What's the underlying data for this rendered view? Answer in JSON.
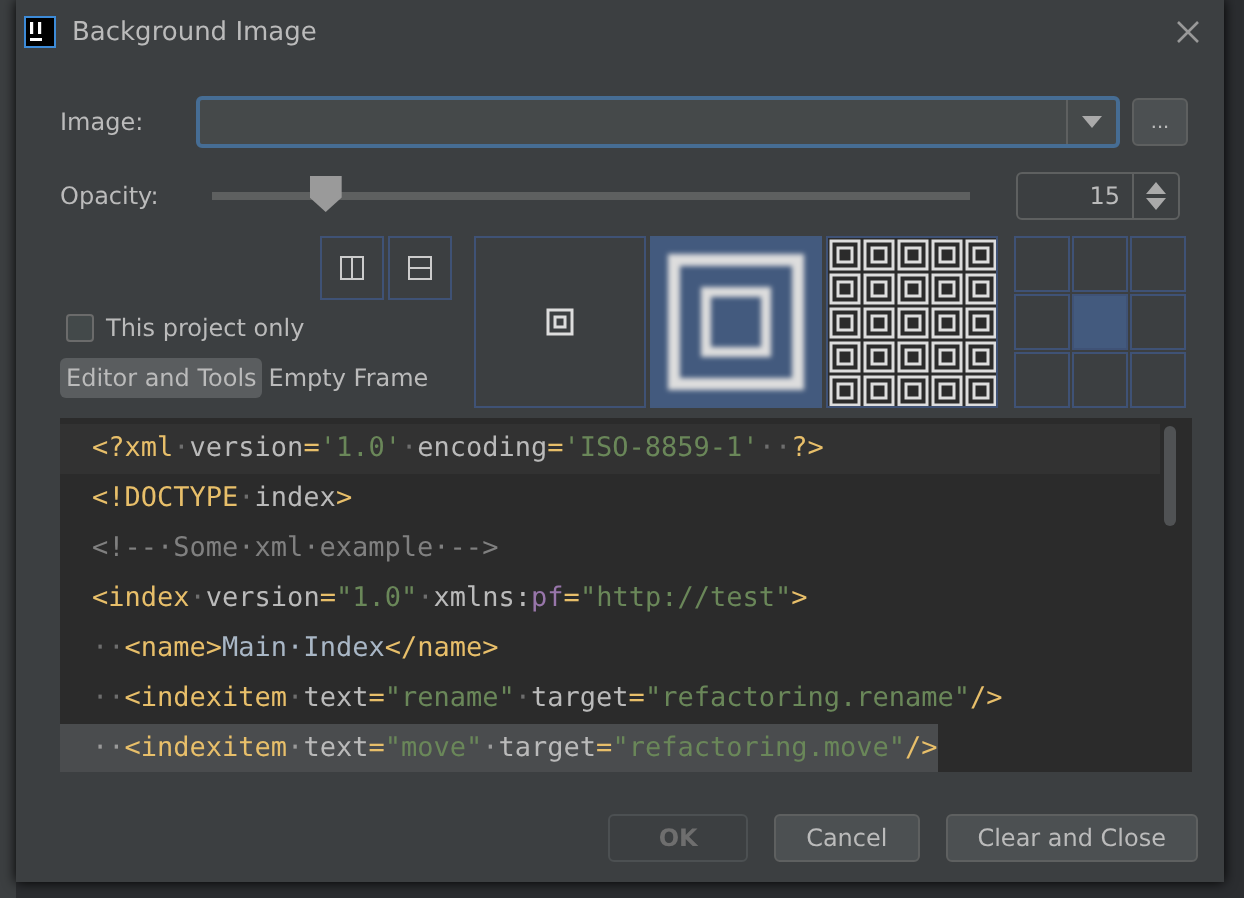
{
  "window": {
    "title": "Background Image"
  },
  "image": {
    "label": "Image:",
    "browse": "..."
  },
  "opacity": {
    "label": "Opacity:",
    "level": 0.15,
    "value": "15"
  },
  "this_project_only": {
    "label": "This project only",
    "checked": false
  },
  "tabs": [
    {
      "label": "Editor and Tools",
      "selected": true
    },
    {
      "label": "Empty Frame",
      "selected": false
    }
  ],
  "fill_modes": [
    {
      "kind": "center",
      "selected": false
    },
    {
      "kind": "scale",
      "selected": true
    },
    {
      "kind": "tile",
      "selected": false
    }
  ],
  "anchors": [
    {
      "selected": false
    },
    {
      "selected": false
    },
    {
      "selected": false
    },
    {
      "selected": false
    },
    {
      "selected": true
    },
    {
      "selected": false
    },
    {
      "selected": false
    },
    {
      "selected": false
    },
    {
      "selected": false
    }
  ],
  "code_lines": [
    {
      "highlighted": true,
      "selected": false,
      "tokens": [
        {
          "kind": "tag",
          "t": "<?xml"
        },
        {
          "kind": "ws",
          "t": "·"
        },
        {
          "kind": "attr",
          "t": "version"
        },
        {
          "kind": "tag",
          "t": "="
        },
        {
          "kind": "value",
          "t": "'1.0'"
        },
        {
          "kind": "ws",
          "t": "·"
        },
        {
          "kind": "attr",
          "t": "encoding"
        },
        {
          "kind": "tag",
          "t": "="
        },
        {
          "kind": "value",
          "t": "'ISO-8859-1'"
        },
        {
          "kind": "ws",
          "t": "··"
        },
        {
          "kind": "tag",
          "t": "?>"
        }
      ]
    },
    {
      "highlighted": false,
      "selected": false,
      "tokens": [
        {
          "kind": "tag",
          "t": "<!DOCTYPE"
        },
        {
          "kind": "ws",
          "t": "·"
        },
        {
          "kind": "attr",
          "t": "index"
        },
        {
          "kind": "tag",
          "t": ">"
        }
      ]
    },
    {
      "highlighted": false,
      "selected": false,
      "tokens": [
        {
          "kind": "comment",
          "t": "<!--·Some·xml·example·-->"
        }
      ]
    },
    {
      "highlighted": false,
      "selected": false,
      "tokens": [
        {
          "kind": "tag",
          "t": "<index"
        },
        {
          "kind": "ws",
          "t": "·"
        },
        {
          "kind": "attr",
          "t": "version"
        },
        {
          "kind": "tag",
          "t": "="
        },
        {
          "kind": "value",
          "t": "\"1.0\""
        },
        {
          "kind": "ws",
          "t": "·"
        },
        {
          "kind": "attr",
          "t": "xmlns:"
        },
        {
          "kind": "ns",
          "t": "pf"
        },
        {
          "kind": "tag",
          "t": "="
        },
        {
          "kind": "value",
          "t": "\"http://test\""
        },
        {
          "kind": "tag",
          "t": ">"
        }
      ]
    },
    {
      "highlighted": false,
      "selected": false,
      "tokens": [
        {
          "kind": "ws",
          "t": "··"
        },
        {
          "kind": "tag",
          "t": "<name>"
        },
        {
          "kind": "text",
          "t": "Main·Index"
        },
        {
          "kind": "tag",
          "t": "</name>"
        }
      ]
    },
    {
      "highlighted": false,
      "selected": false,
      "tokens": [
        {
          "kind": "ws",
          "t": "··"
        },
        {
          "kind": "tag",
          "t": "<indexitem"
        },
        {
          "kind": "ws",
          "t": "·"
        },
        {
          "kind": "attr",
          "t": "text"
        },
        {
          "kind": "tag",
          "t": "="
        },
        {
          "kind": "value",
          "t": "\"rename\""
        },
        {
          "kind": "ws",
          "t": "·"
        },
        {
          "kind": "attr",
          "t": "target"
        },
        {
          "kind": "tag",
          "t": "="
        },
        {
          "kind": "value",
          "t": "\"refactoring.rename\""
        },
        {
          "kind": "tag",
          "t": "/>"
        }
      ]
    },
    {
      "highlighted": false,
      "selected": true,
      "tokens": [
        {
          "kind": "ws",
          "t": "··"
        },
        {
          "kind": "tag",
          "t": "<indexitem"
        },
        {
          "kind": "ws",
          "t": "·"
        },
        {
          "kind": "attr",
          "t": "text"
        },
        {
          "kind": "tag",
          "t": "="
        },
        {
          "kind": "value",
          "t": "\"move\""
        },
        {
          "kind": "ws",
          "t": "·"
        },
        {
          "kind": "attr",
          "t": "target"
        },
        {
          "kind": "tag",
          "t": "="
        },
        {
          "kind": "value",
          "t": "\"refactoring.move\""
        },
        {
          "kind": "tag",
          "t": "/>"
        }
      ]
    }
  ],
  "buttons": [
    {
      "label": "OK",
      "disabled": true
    },
    {
      "label": "Cancel",
      "disabled": false
    },
    {
      "label": "Clear and Close",
      "disabled": false
    }
  ]
}
